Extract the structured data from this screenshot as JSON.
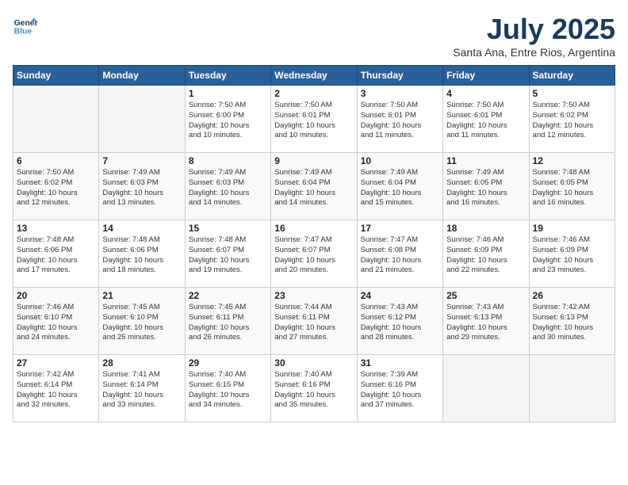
{
  "header": {
    "logo_line1": "General",
    "logo_line2": "Blue",
    "month": "July 2025",
    "location": "Santa Ana, Entre Rios, Argentina"
  },
  "days_of_week": [
    "Sunday",
    "Monday",
    "Tuesday",
    "Wednesday",
    "Thursday",
    "Friday",
    "Saturday"
  ],
  "weeks": [
    [
      {
        "day": "",
        "info": ""
      },
      {
        "day": "",
        "info": ""
      },
      {
        "day": "1",
        "info": "Sunrise: 7:50 AM\nSunset: 6:00 PM\nDaylight: 10 hours\nand 10 minutes."
      },
      {
        "day": "2",
        "info": "Sunrise: 7:50 AM\nSunset: 6:01 PM\nDaylight: 10 hours\nand 10 minutes."
      },
      {
        "day": "3",
        "info": "Sunrise: 7:50 AM\nSunset: 6:01 PM\nDaylight: 10 hours\nand 11 minutes."
      },
      {
        "day": "4",
        "info": "Sunrise: 7:50 AM\nSunset: 6:01 PM\nDaylight: 10 hours\nand 11 minutes."
      },
      {
        "day": "5",
        "info": "Sunrise: 7:50 AM\nSunset: 6:02 PM\nDaylight: 10 hours\nand 12 minutes."
      }
    ],
    [
      {
        "day": "6",
        "info": "Sunrise: 7:50 AM\nSunset: 6:02 PM\nDaylight: 10 hours\nand 12 minutes."
      },
      {
        "day": "7",
        "info": "Sunrise: 7:49 AM\nSunset: 6:03 PM\nDaylight: 10 hours\nand 13 minutes."
      },
      {
        "day": "8",
        "info": "Sunrise: 7:49 AM\nSunset: 6:03 PM\nDaylight: 10 hours\nand 14 minutes."
      },
      {
        "day": "9",
        "info": "Sunrise: 7:49 AM\nSunset: 6:04 PM\nDaylight: 10 hours\nand 14 minutes."
      },
      {
        "day": "10",
        "info": "Sunrise: 7:49 AM\nSunset: 6:04 PM\nDaylight: 10 hours\nand 15 minutes."
      },
      {
        "day": "11",
        "info": "Sunrise: 7:49 AM\nSunset: 6:05 PM\nDaylight: 10 hours\nand 16 minutes."
      },
      {
        "day": "12",
        "info": "Sunrise: 7:48 AM\nSunset: 6:05 PM\nDaylight: 10 hours\nand 16 minutes."
      }
    ],
    [
      {
        "day": "13",
        "info": "Sunrise: 7:48 AM\nSunset: 6:06 PM\nDaylight: 10 hours\nand 17 minutes."
      },
      {
        "day": "14",
        "info": "Sunrise: 7:48 AM\nSunset: 6:06 PM\nDaylight: 10 hours\nand 18 minutes."
      },
      {
        "day": "15",
        "info": "Sunrise: 7:48 AM\nSunset: 6:07 PM\nDaylight: 10 hours\nand 19 minutes."
      },
      {
        "day": "16",
        "info": "Sunrise: 7:47 AM\nSunset: 6:07 PM\nDaylight: 10 hours\nand 20 minutes."
      },
      {
        "day": "17",
        "info": "Sunrise: 7:47 AM\nSunset: 6:08 PM\nDaylight: 10 hours\nand 21 minutes."
      },
      {
        "day": "18",
        "info": "Sunrise: 7:46 AM\nSunset: 6:09 PM\nDaylight: 10 hours\nand 22 minutes."
      },
      {
        "day": "19",
        "info": "Sunrise: 7:46 AM\nSunset: 6:09 PM\nDaylight: 10 hours\nand 23 minutes."
      }
    ],
    [
      {
        "day": "20",
        "info": "Sunrise: 7:46 AM\nSunset: 6:10 PM\nDaylight: 10 hours\nand 24 minutes."
      },
      {
        "day": "21",
        "info": "Sunrise: 7:45 AM\nSunset: 6:10 PM\nDaylight: 10 hours\nand 25 minutes."
      },
      {
        "day": "22",
        "info": "Sunrise: 7:45 AM\nSunset: 6:11 PM\nDaylight: 10 hours\nand 26 minutes."
      },
      {
        "day": "23",
        "info": "Sunrise: 7:44 AM\nSunset: 6:11 PM\nDaylight: 10 hours\nand 27 minutes."
      },
      {
        "day": "24",
        "info": "Sunrise: 7:43 AM\nSunset: 6:12 PM\nDaylight: 10 hours\nand 28 minutes."
      },
      {
        "day": "25",
        "info": "Sunrise: 7:43 AM\nSunset: 6:13 PM\nDaylight: 10 hours\nand 29 minutes."
      },
      {
        "day": "26",
        "info": "Sunrise: 7:42 AM\nSunset: 6:13 PM\nDaylight: 10 hours\nand 30 minutes."
      }
    ],
    [
      {
        "day": "27",
        "info": "Sunrise: 7:42 AM\nSunset: 6:14 PM\nDaylight: 10 hours\nand 32 minutes."
      },
      {
        "day": "28",
        "info": "Sunrise: 7:41 AM\nSunset: 6:14 PM\nDaylight: 10 hours\nand 33 minutes."
      },
      {
        "day": "29",
        "info": "Sunrise: 7:40 AM\nSunset: 6:15 PM\nDaylight: 10 hours\nand 34 minutes."
      },
      {
        "day": "30",
        "info": "Sunrise: 7:40 AM\nSunset: 6:16 PM\nDaylight: 10 hours\nand 35 minutes."
      },
      {
        "day": "31",
        "info": "Sunrise: 7:39 AM\nSunset: 6:16 PM\nDaylight: 10 hours\nand 37 minutes."
      },
      {
        "day": "",
        "info": ""
      },
      {
        "day": "",
        "info": ""
      }
    ]
  ]
}
